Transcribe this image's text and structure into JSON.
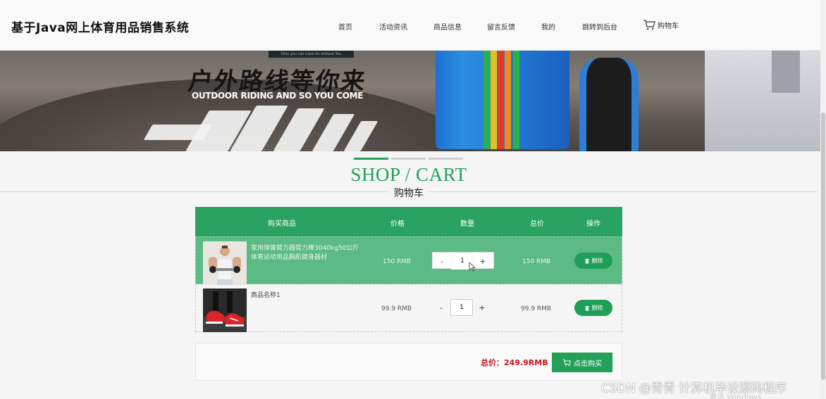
{
  "header": {
    "site_title": "基于Java网上体育用品销售系统",
    "nav": [
      {
        "label": "首页"
      },
      {
        "label": "活动资讯"
      },
      {
        "label": "商品信息"
      },
      {
        "label": "留言反馈"
      },
      {
        "label": "我的"
      },
      {
        "label": "跳转到后台"
      }
    ],
    "cart_label": "购物车",
    "cart_icon": "cart-icon"
  },
  "banner": {
    "top_box_text": "Only you can Cann its without You",
    "headline_zh": "户外路线等你来",
    "headline_en": "OUTDOOR RIDING AND SO YOU COME"
  },
  "carousel": {
    "slides": 3,
    "active_index": 0,
    "active_color": "#24a159",
    "inactive_color": "#d0d0d0"
  },
  "section": {
    "title_en": "SHOP / CART",
    "title_zh": "购物车"
  },
  "cart": {
    "columns": [
      "购买商品",
      "价格",
      "数量",
      "总价",
      "操作"
    ],
    "items": [
      {
        "name": "家用弹簧臂力器臂力棒3040kg50公斤体育运动用品胸肌健身器材",
        "price": "150 RMB",
        "quantity": "1",
        "total": "150 RMB",
        "delete_label": "删除",
        "minus": "-",
        "plus": "+"
      },
      {
        "name": "商品名称1",
        "price": "99.9 RMB",
        "quantity": "1",
        "total": "99.9 RMB",
        "delete_label": "删除",
        "minus": "-",
        "plus": "+"
      }
    ]
  },
  "summary": {
    "total_label": "总价：249.9RMB",
    "buy_label": "点击购买"
  },
  "overlay": {
    "watermark": "CSDN @青青  计算机毕设源码程序",
    "windows_activate": "激活 Windows"
  },
  "colors": {
    "accent": "#24a159",
    "header_row": "#29a35f",
    "highlight_row": "#5cba84",
    "total_red": "#c0151c"
  }
}
